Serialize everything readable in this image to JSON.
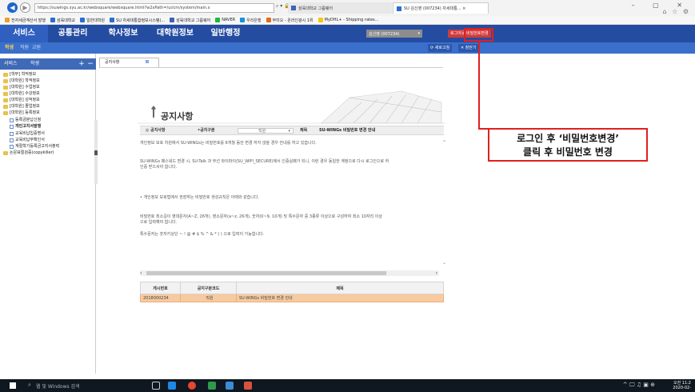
{
  "browser": {
    "url": "https://suwings.syu.ac.kr/websquare/websquare.html?w2xPath=/ui/cm/system/main.x",
    "url_controls": "⌕ ▾ 🔒 C",
    "tabs": [
      {
        "label": "삼육대학교 그룹웨어"
      },
      {
        "label": "SU 김신영 (007234) 차세대통... ×"
      }
    ],
    "window_controls": "–  ▢  ✕",
    "home_icons": "⌂ ☆ ⚙",
    "favorites": [
      {
        "label": "전자세금계산서 발행",
        "color": "#e9a12c"
      },
      {
        "label": "삼육대학교",
        "color": "#2a6dd1"
      },
      {
        "label": "일반대학원",
        "color": "#2a6dd1"
      },
      {
        "label": "SU 차세대통합정보시스템(...",
        "color": "#2a6dd1"
      },
      {
        "label": "삼육대학교 그룹웨어",
        "color": "#3d63b8"
      },
      {
        "label": "NAVER",
        "color": "#1fba3a"
      },
      {
        "label": "우리은행",
        "color": "#1a8fdc"
      },
      {
        "label": "부미오 - 온라인광시 1위",
        "color": "#e56a1c"
      },
      {
        "label": "MyDHL+ - Shipping rates...",
        "color": "#f5c518"
      }
    ]
  },
  "menu": {
    "items": [
      "서비스",
      "공통관리",
      "학사정보",
      "대학원정보",
      "일반행정"
    ],
    "user": "김신영 (007234)",
    "logout": "로그아웃",
    "change_password": "비밀번호변경",
    "subtabs": [
      "학생",
      "직원",
      "교원"
    ],
    "refresh": "새로고침",
    "close_all": "창닫기"
  },
  "sidebar": {
    "tabs": [
      "서비스",
      "학생"
    ],
    "plus": "+",
    "minus": "−",
    "items": [
      {
        "label": "[학부] 학적정보",
        "icon": "folder"
      },
      {
        "label": "[대학원] 학적정보",
        "icon": "folder"
      },
      {
        "label": "[대학원] 수업정보",
        "icon": "folder"
      },
      {
        "label": "[대학원] 수강정보",
        "icon": "folder"
      },
      {
        "label": "[대학원] 성적정보",
        "icon": "folder"
      },
      {
        "label": "[대학원] 졸업정보",
        "icon": "folder"
      },
      {
        "label": "[대학원] 등록정보",
        "icon": "folder"
      },
      {
        "label": "등록금분납신청",
        "icon": "doc"
      },
      {
        "label": "개인고지서발행",
        "icon": "doc"
      },
      {
        "label": "교육비납입증명서",
        "icon": "doc"
      },
      {
        "label": "교육비납부확인서",
        "icon": "doc"
      },
      {
        "label": "계절학기등록금고지서출력",
        "icon": "doc"
      },
      {
        "label": "논문표절검증(copykiller)",
        "icon": "folder"
      }
    ]
  },
  "content": {
    "tab_label": "공지사항",
    "tab_close": "⊠",
    "title": "공지사항",
    "filter": {
      "notice_label": "공지사항",
      "category_label": "•공지구분",
      "category_value": "직원",
      "title_label": "제목",
      "title_value": "SU-WINGs 비밀번호 변경 안내"
    },
    "paragraphs": [
      "개인정보 보호 차원에서 SU-WINGs는 비밀번호를 6개월 동안 변경 하지 않을 경우 안내를 하고 있습니다.",
      "SU-WINGs 패스워드 변경 시, SU-Talk 과 무선 와이파이(SU_WIFI_SECURE)에서 인증실패가 되니, 이런 경우 동일한 계정으로 다시 로그인으로 하",
      "인증 받으셔야 합니다.",
      "• 개인정보 보호법에서 권장하는 비밀번호 생성규칙은 아래와 같습니다.",
      "비밀번호 최소길이 영대문자(A~Z, 26개), 영소문자(a~z, 26개), 숫자(0~9, 10개) 및 특수문자 중 3종류 이상으로 구성하여 최소 10자리 이상",
      "으로 입력해야 합니다.",
      "특수문자는 숫자키상단 ~ ! @ # $ % ^ & * ( ) 으로 입력이 가능합니다."
    ],
    "table": {
      "headers": [
        "게시번호",
        "공지구분코드",
        "제목"
      ],
      "rows": [
        [
          "2018000234",
          "직원",
          "SU-WINGs 비밀번호 변경 안내"
        ]
      ]
    }
  },
  "annotation": {
    "line1": "로그인 후 ‘비밀번호변경’",
    "line2": "클릭 후 비밀번호 변경"
  },
  "taskbar": {
    "search_placeholder": "웹 및 Windows 검색",
    "tray": "^ 🖵 ♫ ▣ ⊕",
    "time": "오전 11:2",
    "date": "2020-02-"
  },
  "colors": {
    "menu_bar": "#244da2",
    "sub_bar": "#3a6fcb",
    "highlight_row": "#f7caa0",
    "annotation_red": "#e02020"
  }
}
